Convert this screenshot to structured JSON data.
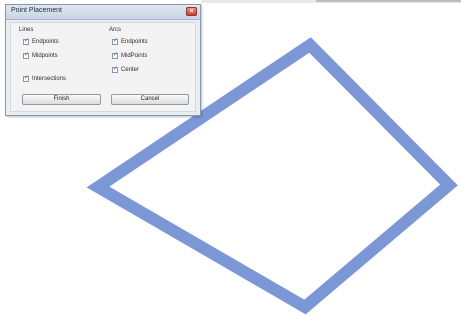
{
  "dialog": {
    "title": "Point Placement",
    "close_glyph": "×",
    "lines_group": {
      "title": "Lines",
      "items": [
        {
          "label": "Endpoints",
          "checked": true
        },
        {
          "label": "Midpoints",
          "checked": true
        },
        {
          "label": "Intersections",
          "checked": true
        }
      ]
    },
    "arcs_group": {
      "title": "Arcs",
      "items": [
        {
          "label": "Endpoints",
          "checked": true
        },
        {
          "label": "MidPoints",
          "checked": true
        },
        {
          "label": "Center",
          "checked": true
        }
      ]
    },
    "finish_label": "Finish",
    "cancel_label": "Cancel"
  },
  "canvas": {
    "shape": "diamond",
    "stroke_color": "#7b97d6",
    "background_color": "#ffffff"
  },
  "check_glyph": "✓"
}
